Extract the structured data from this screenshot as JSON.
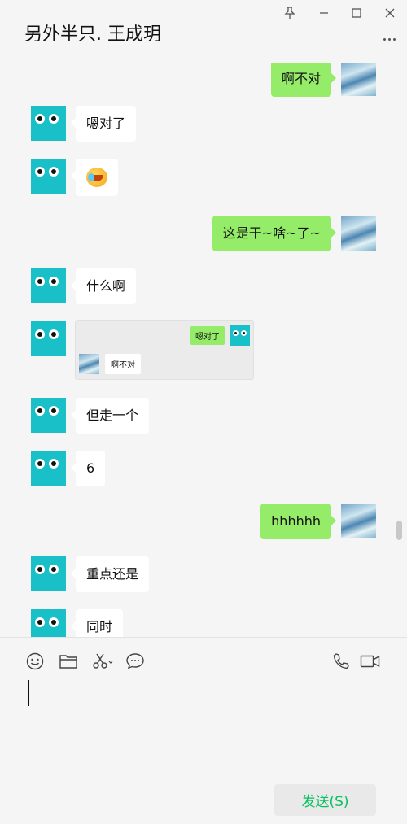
{
  "window": {
    "title": "另外半只. 王成玥",
    "controls": {
      "pin": "pin-icon",
      "minimize": "minimize-icon",
      "maximize": "maximize-icon",
      "close": "close-icon"
    }
  },
  "messages": [
    {
      "from": "self",
      "text": "啊不对"
    },
    {
      "from": "other",
      "text": "嗯对了"
    },
    {
      "from": "other",
      "type": "emoji",
      "emoji": "laughing-crying-face"
    },
    {
      "from": "self",
      "text": "这是干~啥~了~"
    },
    {
      "from": "other",
      "text": "什么啊"
    },
    {
      "from": "other",
      "type": "quoted-screenshot",
      "quote": {
        "right_text": "嗯对了",
        "left_text": "啊不对"
      }
    },
    {
      "from": "other",
      "text": "但走一个"
    },
    {
      "from": "other",
      "text": "6"
    },
    {
      "from": "self",
      "text": "hhhhhh"
    },
    {
      "from": "other",
      "text": "重点还是"
    },
    {
      "from": "other",
      "text": "同时"
    }
  ],
  "toolbar": {
    "icons": [
      "emoji-icon",
      "folder-icon",
      "scissors-icon",
      "chat-bubble-icon",
      "phone-icon",
      "video-icon"
    ]
  },
  "input": {
    "value": ""
  },
  "send_button": {
    "label": "发送(S)"
  },
  "colors": {
    "self_bubble": "#95ec69",
    "other_bubble": "#ffffff",
    "avatar_other": "#19c0c8",
    "send_text": "#07c160",
    "background": "#f5f5f5"
  }
}
